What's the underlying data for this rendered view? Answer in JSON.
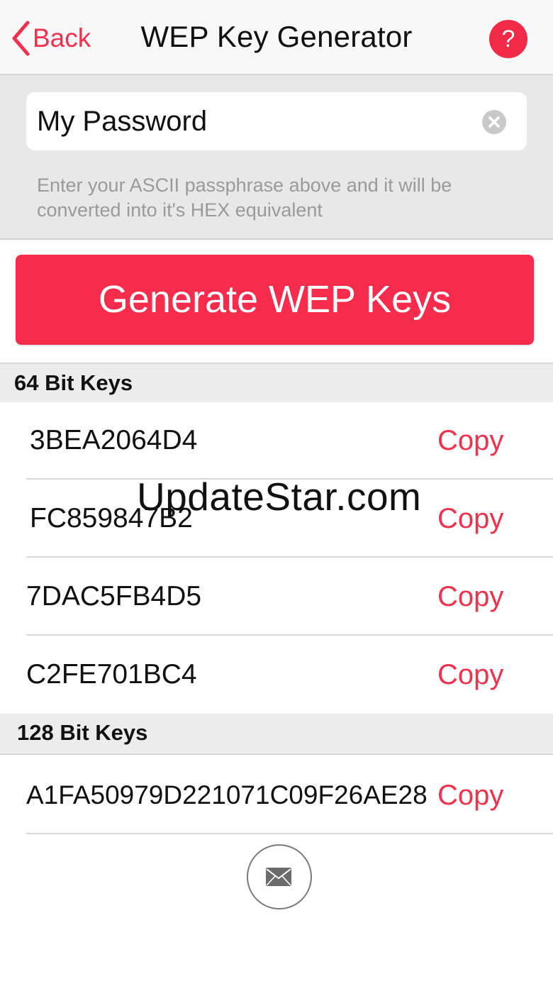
{
  "navbar": {
    "back_label": "Back",
    "title": "WEP Key Generator",
    "help_label": "?"
  },
  "input": {
    "value": "My Password",
    "hint": "Enter your ASCII passphrase above and it will be converted into it's HEX equivalent"
  },
  "generate_button": "Generate WEP Keys",
  "sections": {
    "bit64": {
      "title": "64 Bit Keys",
      "keys": [
        "3BEA2064D4",
        "FC859847B2",
        "7DAC5FB4D5",
        "C2FE701BC4"
      ]
    },
    "bit128": {
      "title": "128 Bit Keys",
      "keys": [
        "A1FA50979D221071C09F26AE28"
      ]
    }
  },
  "copy_label": "Copy",
  "watermark": "UpdateStar.com",
  "colors": {
    "accent": "#f0324f",
    "button": "#f72b4b",
    "section_bg": "#ececec"
  }
}
